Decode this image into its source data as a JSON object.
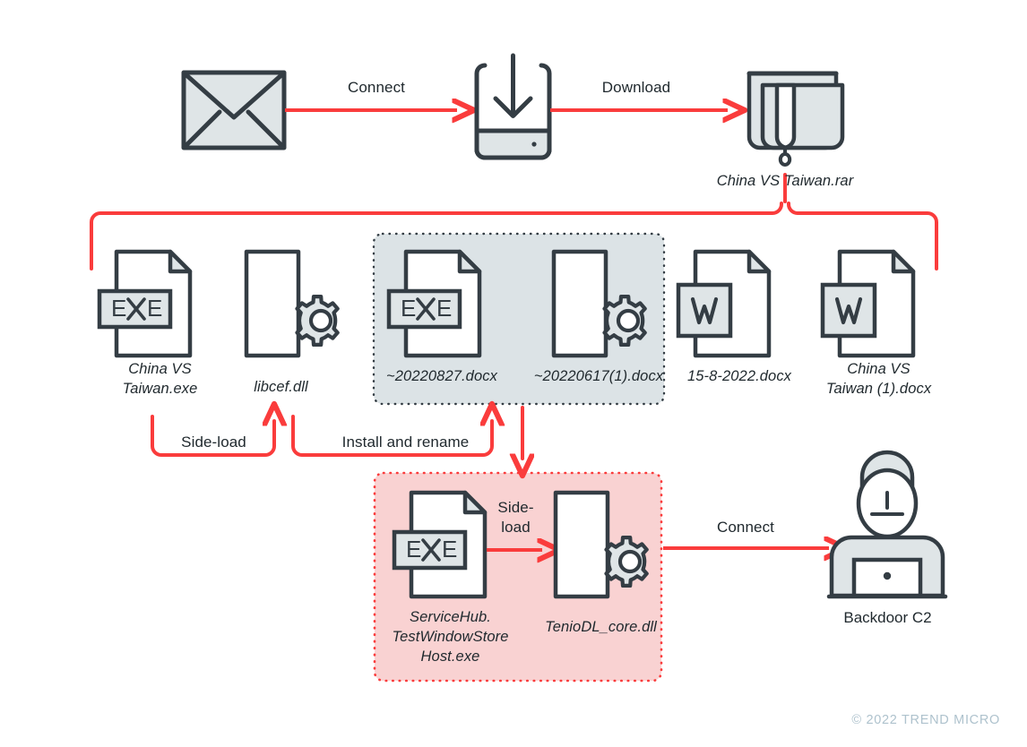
{
  "diagram": {
    "title": "Infection chain diagram",
    "colors": {
      "stroke_dark": "#343d44",
      "fill_light": "#dfe5e7",
      "accent_red": "#fa3c3c",
      "box_gray_fill": "#dce3e6",
      "box_gray_border": "#343d44",
      "box_pink_fill": "#f9d2d2",
      "box_pink_border": "#fa3c3c",
      "background": "#ffffff",
      "copyright_color": "#aec2cd"
    },
    "nodes": {
      "email": {
        "icon": "envelope-icon",
        "label": ""
      },
      "download": {
        "icon": "download-device-icon",
        "label": ""
      },
      "archive": {
        "icon": "archive-rar-icon",
        "label": "China VS Taiwan.rar"
      },
      "exe_taiwan": {
        "icon": "exe-file-icon",
        "label": "China VS\nTaiwan.exe"
      },
      "libcef": {
        "icon": "dll-gear-file-icon",
        "label": "libcef.dll"
      },
      "docx_20220827": {
        "icon": "exe-file-icon",
        "label": "~20220827.docx"
      },
      "docx_20220617": {
        "icon": "dll-gear-file-icon",
        "label": "~20220617(1).docx"
      },
      "docx_15_8_2022": {
        "icon": "word-file-icon",
        "label": "15-8-2022.docx"
      },
      "docx_china_vs_taiwan_1": {
        "icon": "word-file-icon",
        "label": "China VS\nTaiwan (1).docx"
      },
      "servicehub_exe": {
        "icon": "exe-file-icon",
        "label": "ServiceHub.\nTestWindowStore\nHost.exe"
      },
      "teniodl_dll": {
        "icon": "dll-gear-file-icon",
        "label": "TenioDL_core.dll"
      },
      "backdoor": {
        "icon": "hacker-person-icon",
        "label": "Backdoor C2"
      }
    },
    "edges": {
      "connect_top": "Connect",
      "download": "Download",
      "side_load_left": "Side-load",
      "install_rename": "Install and rename",
      "side_load_pink": "Side-\nload",
      "connect_bottom": "Connect"
    },
    "groups": {
      "gray_box": {
        "style": "dotted",
        "fill": "#dce3e6"
      },
      "pink_box": {
        "style": "dotted",
        "fill": "#f9d2d2"
      }
    },
    "footer": {
      "copyright": "© 2022 TREND MICRO"
    }
  }
}
